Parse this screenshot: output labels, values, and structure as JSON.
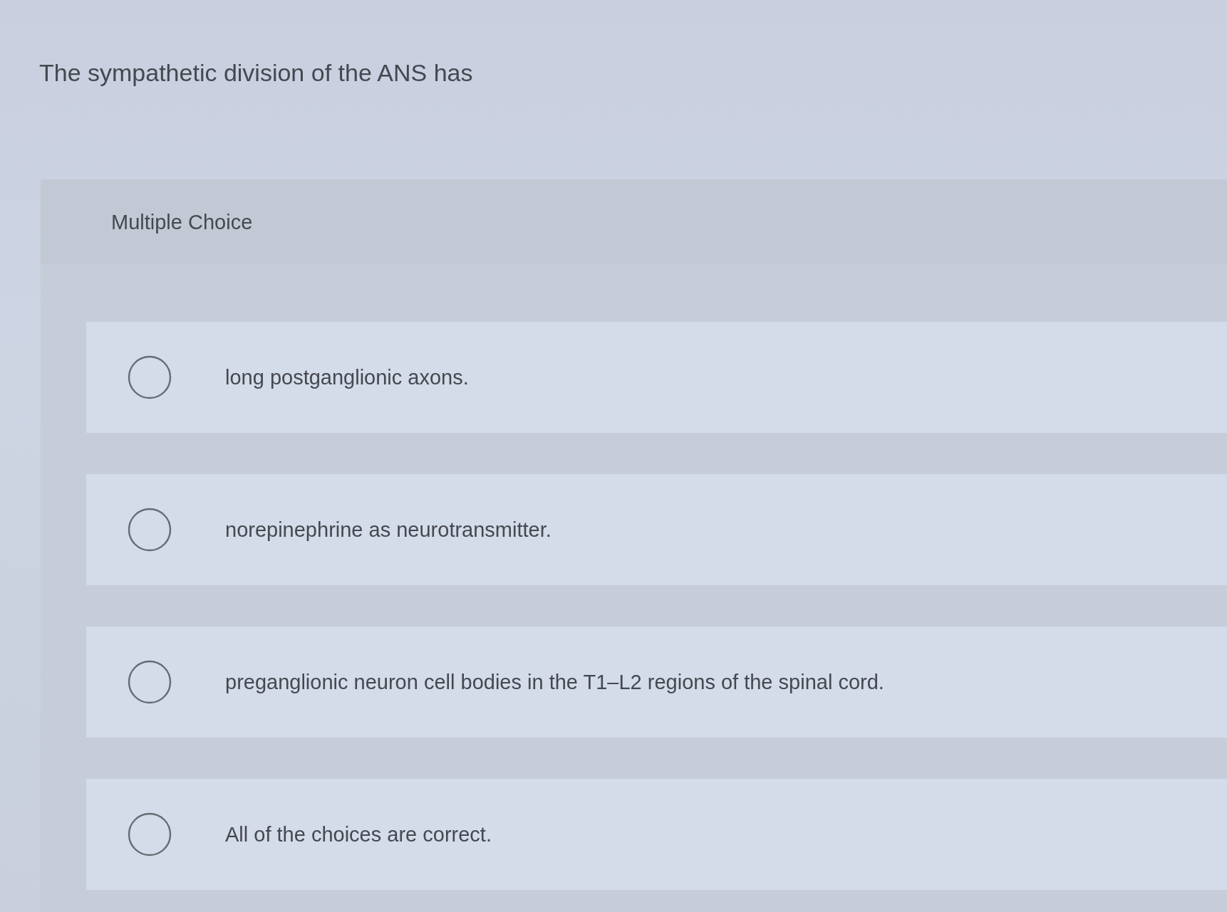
{
  "question": "The sympathetic division of the ANS has",
  "section": {
    "label": "Multiple Choice"
  },
  "options": [
    {
      "text": "long postganglionic axons.",
      "selected": false
    },
    {
      "text": "norepinephrine as neurotransmitter.",
      "selected": false
    },
    {
      "text": "preganglionic neuron cell bodies in the T1–L2 regions of the spinal cord.",
      "selected": false
    },
    {
      "text": "All of the choices are correct.",
      "selected": false
    }
  ]
}
